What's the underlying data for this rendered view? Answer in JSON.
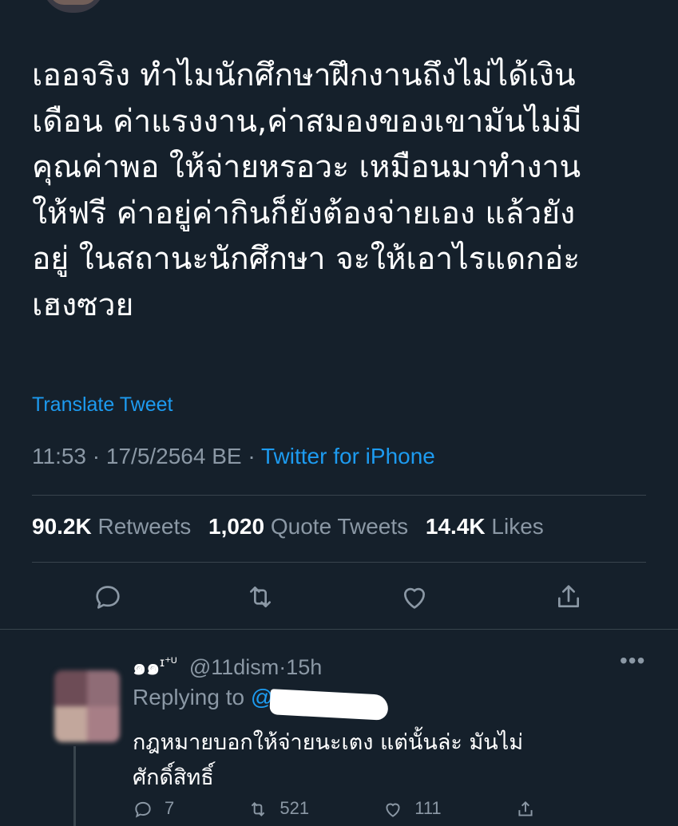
{
  "tweet": {
    "text": "เออจริง ทำไมนักศึกษาฝึกงานถึงไม่ได้เงิน\nเดือน ค่าแรงงาน,ค่าสมองของเขามันไม่มี\nคุณค่าพอ ให้จ่ายหรอวะ เหมือนมาทำงาน\nให้ฟรี ค่าอยู่ค่ากินก็ยังต้องจ่ายเอง แล้วยัง\nอยู่ ในสถานะนักศึกษา จะให้เอาไรแดกอ่ะ\nเฮงซวย",
    "translate_label": "Translate Tweet",
    "time": "11:53",
    "date": "17/5/2564 BE",
    "separator": "·",
    "source": "Twitter for iPhone"
  },
  "stats": {
    "retweets_count": "90.2K",
    "retweets_label": "Retweets",
    "quotes_count": "1,020",
    "quotes_label": "Quote Tweets",
    "likes_count": "14.4K",
    "likes_label": "Likes"
  },
  "actions": [
    "reply-icon",
    "retweet-icon",
    "like-icon",
    "share-icon"
  ],
  "reply": {
    "name": "๑๑",
    "badge": "ɪ⁺ᵁ",
    "handle": "@11dism",
    "dot": "·",
    "age": "15h",
    "more": "•••",
    "replying_to_label": "Replying to",
    "replying_to_handle": "@",
    "text": "กฎหมายบอกให้จ่ายนะเตง แต่นั้นล่ะ มันไม่\nศักดิ์สิทธิ์",
    "reply_count": "7",
    "retweet_count": "521",
    "like_count": "111"
  },
  "colors": {
    "background": "#15202b",
    "accent": "#1d9bf0",
    "secondary_text": "#8b98a5",
    "divider": "#38444d"
  }
}
